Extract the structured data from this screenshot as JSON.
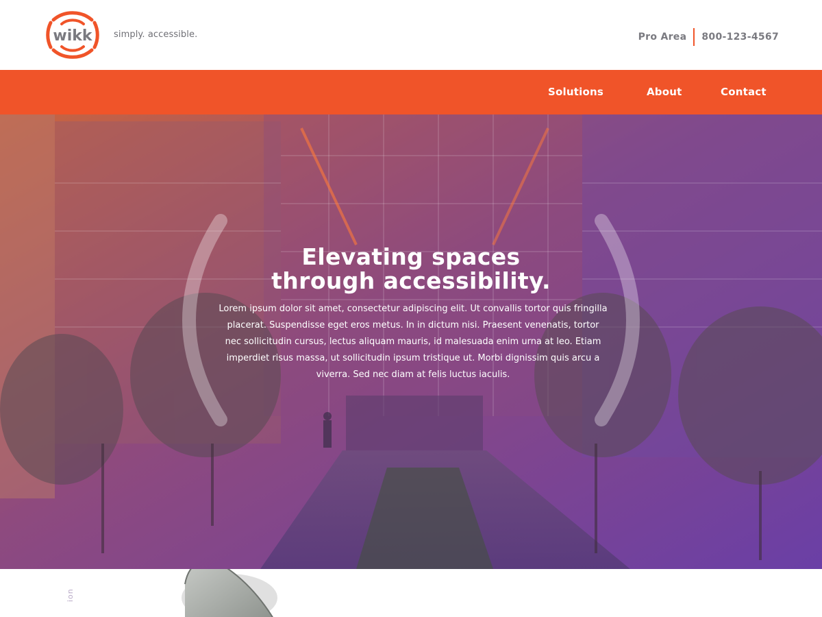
{
  "brand": {
    "logo_text": "wikk",
    "tagline": "simply. accessible."
  },
  "topbar": {
    "pro_area": "Pro Area",
    "phone": "800-123-4567"
  },
  "nav": {
    "items": [
      {
        "label": "Solutions"
      },
      {
        "label": "About"
      },
      {
        "label": "Contact"
      }
    ]
  },
  "hero": {
    "title_line1": "Elevating spaces",
    "title_line2": "through accessibility.",
    "body": "Lorem ipsum dolor sit amet, consectetur adipiscing elit. Ut convallis tortor quis fringilla placerat. Suspendisse eget eros metus. In in dictum nisi. Praesent venenatis, tortor nec sollicitudin cursus, lectus aliquam mauris, id malesuada enim urna at leo. Etiam imperdiet risus massa, ut sollicitudin ipsum tristique ut. Morbi dignissim quis arcu a viverra. Sed nec diam at felis luctus iaculis."
  },
  "lower": {
    "vertical_label": "ion"
  },
  "colors": {
    "accent": "#f05429",
    "text_gray": "#7a7a80",
    "hero_orange": "#c9643f",
    "hero_purple": "#6a3fa6"
  }
}
